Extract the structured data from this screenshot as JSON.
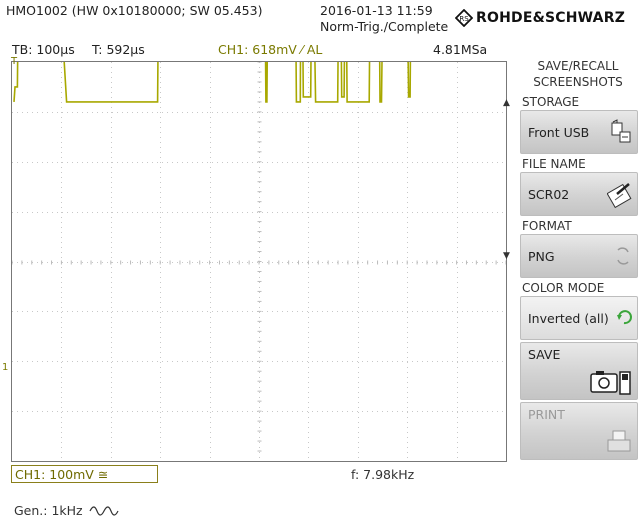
{
  "header": {
    "model": "HMO1002 (HW 0x10180000; SW 05.453)",
    "datetime": "2016-01-13 11:59",
    "trigger_state": "Norm-Trig./Complete",
    "brand": "ROHDE&SCHWARZ"
  },
  "status": {
    "timebase": "TB: 100µs",
    "trigger_time": "T: 592µs",
    "trigger_channel": "CH1: 618mV ⁄ AL",
    "sample_rate": "4.81MSa"
  },
  "markers": {
    "trigger_pos": "T",
    "ch1_marker": "1"
  },
  "footer": {
    "ch1_scale": "CH1: 100mV ≅",
    "frequency": "f: 7.98kHz",
    "generator": "Gen.: 1kHz"
  },
  "menu": {
    "title": "SAVE/RECALL\nSCREENSHOTS",
    "storage_label": "STORAGE",
    "storage_value": "Front USB",
    "file_name_label": "FILE NAME",
    "file_name_value": "SCR02",
    "format_label": "FORMAT",
    "format_value": "PNG",
    "color_mode_label": "COLOR MODE",
    "color_mode_value": "Inverted (all)",
    "save_label": "SAVE",
    "print_label": "PRINT"
  },
  "colors": {
    "trace": "#a8a800",
    "ch1": "#7a7a00",
    "grid": "#c8c8c8"
  },
  "chart_data": {
    "type": "line",
    "title": "",
    "xlabel": "",
    "ylabel": "",
    "x_unit": "µs",
    "y_unit": "mV",
    "grid": true,
    "series": [
      {
        "x": [
          -592,
          -590,
          -585,
          -583,
          -581,
          -500,
          -485,
          -300,
          -298,
          -296,
          -150,
          -148,
          -82,
          -80,
          -78,
          -76,
          -20,
          -18,
          -10,
          -9,
          -6,
          -4,
          11,
          13,
          17,
          21,
          66,
          68,
          72,
          74,
          79,
          81,
          83,
          85,
          130,
          132,
          150,
          152,
          155,
          158,
          207,
          210,
          213,
          215
        ],
        "y": [
          320,
          350,
          350,
          560,
          560,
          568,
          320,
          320,
          568,
          568,
          568,
          568,
          568,
          320,
          320,
          568,
          568,
          320,
          320,
          568,
          568,
          330,
          330,
          568,
          568,
          320,
          320,
          568,
          568,
          330,
          330,
          568,
          568,
          320,
          320,
          568,
          568,
          320,
          320,
          568,
          568,
          330,
          330,
          568
        ]
      }
    ],
    "xlim": [
      -596,
      408
    ],
    "ylim": [
      -400,
      400
    ]
  }
}
